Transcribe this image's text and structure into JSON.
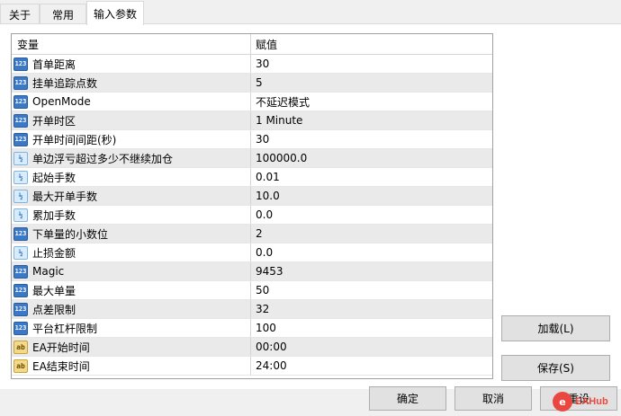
{
  "tabs": [
    {
      "label": "关于",
      "active": false
    },
    {
      "label": "常用",
      "active": false
    },
    {
      "label": "输入参数",
      "active": true
    }
  ],
  "grid": {
    "header": {
      "name": "变量",
      "value": "赋值"
    },
    "rows": [
      {
        "type": "int",
        "icon": "123",
        "name": "首单距离",
        "value": "30"
      },
      {
        "type": "int",
        "icon": "123",
        "name": "挂单追踪点数",
        "value": "5"
      },
      {
        "type": "int",
        "icon": "123",
        "name": "OpenMode",
        "value": "不延迟模式"
      },
      {
        "type": "int",
        "icon": "123",
        "name": "开单时区",
        "value": "1 Minute"
      },
      {
        "type": "int",
        "icon": "123",
        "name": "开单时间间距(秒)",
        "value": "30"
      },
      {
        "type": "dbl",
        "icon": "½",
        "name": "单边浮亏超过多少不继续加仓",
        "value": "100000.0"
      },
      {
        "type": "dbl",
        "icon": "½",
        "name": "起始手数",
        "value": "0.01"
      },
      {
        "type": "dbl",
        "icon": "½",
        "name": "最大开单手数",
        "value": "10.0"
      },
      {
        "type": "dbl",
        "icon": "½",
        "name": "累加手数",
        "value": "0.0"
      },
      {
        "type": "int",
        "icon": "123",
        "name": "下单量的小数位",
        "value": "2"
      },
      {
        "type": "dbl",
        "icon": "½",
        "name": "止损金额",
        "value": "0.0"
      },
      {
        "type": "int",
        "icon": "123",
        "name": "Magic",
        "value": "9453"
      },
      {
        "type": "int",
        "icon": "123",
        "name": "最大单量",
        "value": "50"
      },
      {
        "type": "int",
        "icon": "123",
        "name": "点差限制",
        "value": "32"
      },
      {
        "type": "int",
        "icon": "123",
        "name": "平台杠杆限制",
        "value": "100"
      },
      {
        "type": "str",
        "icon": "ab",
        "name": "EA开始时间",
        "value": "00:00"
      },
      {
        "type": "str",
        "icon": "ab",
        "name": "EA结束时间",
        "value": "24:00"
      }
    ]
  },
  "buttons": {
    "load": "加载(L)",
    "save": "保存(S)",
    "ok": "确定",
    "cancel": "取消",
    "reset": "重设"
  },
  "watermark": {
    "logo": "e",
    "text": "EAHub"
  }
}
